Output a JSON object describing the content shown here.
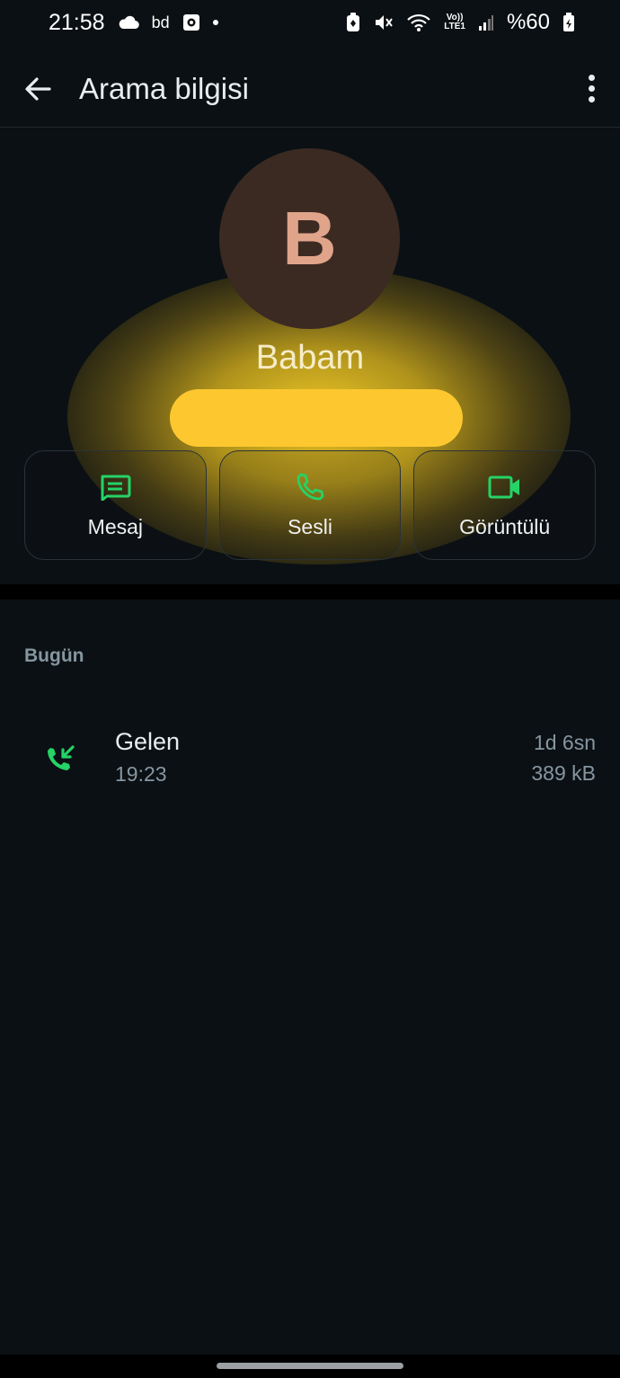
{
  "status_bar": {
    "time": "21:58",
    "notification_icons": [
      "cloud-icon",
      "bd-icon",
      "screen-record-icon",
      "dot-icon"
    ],
    "bd_text": "bd",
    "volte_line1": "Vo))",
    "volte_line2": "LTE1",
    "battery_text": "%60"
  },
  "app_bar": {
    "title": "Arama bilgisi"
  },
  "contact": {
    "avatar_letter": "B",
    "name": "Babam",
    "avatar_color": "#3b2a22",
    "avatar_letter_color": "#e0a48a"
  },
  "actions": [
    {
      "label": "Mesaj",
      "icon": "message-icon"
    },
    {
      "label": "Sesli",
      "icon": "phone-icon"
    },
    {
      "label": "Görüntülü",
      "icon": "video-icon"
    }
  ],
  "colors": {
    "accent_green": "#25d366",
    "background": "#0b1014",
    "highlight_yellow": "#fdc82f"
  },
  "call_log": {
    "section_title": "Bugün",
    "calls": [
      {
        "type": "Gelen",
        "time": "19:23",
        "duration": "1d 6sn",
        "size": "389 kB",
        "icon": "incoming-call-icon"
      }
    ]
  }
}
